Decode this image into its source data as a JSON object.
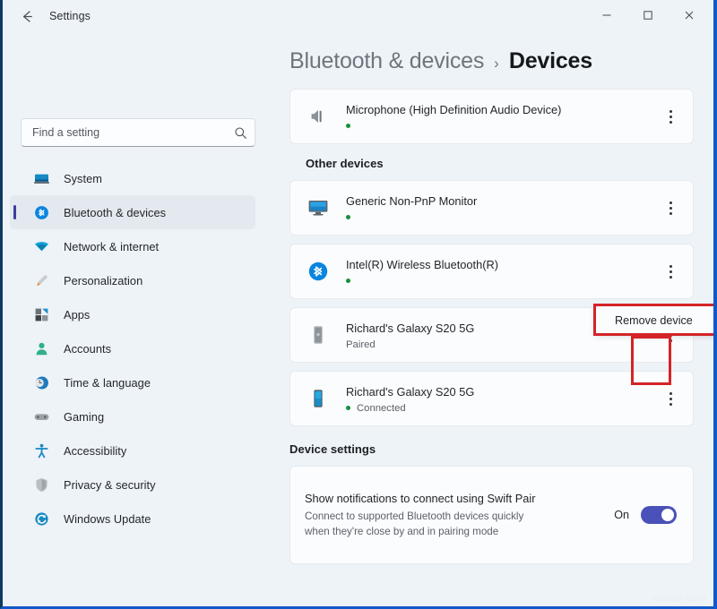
{
  "window": {
    "title": "Settings",
    "back_label": "Back",
    "minimize_label": "Minimize",
    "maximize_label": "Maximize",
    "close_label": "Close",
    "watermark": "wsxdn.com"
  },
  "search": {
    "placeholder": "Find a setting",
    "value": ""
  },
  "sidebar": {
    "items": [
      {
        "label": "System",
        "icon": "monitor-icon",
        "selected": false
      },
      {
        "label": "Bluetooth & devices",
        "icon": "bluetooth-icon",
        "selected": true
      },
      {
        "label": "Network & internet",
        "icon": "wifi-icon",
        "selected": false
      },
      {
        "label": "Personalization",
        "icon": "paintbrush-icon",
        "selected": false
      },
      {
        "label": "Apps",
        "icon": "apps-icon",
        "selected": false
      },
      {
        "label": "Accounts",
        "icon": "person-icon",
        "selected": false
      },
      {
        "label": "Time & language",
        "icon": "clock-globe-icon",
        "selected": false
      },
      {
        "label": "Gaming",
        "icon": "gamepad-icon",
        "selected": false
      },
      {
        "label": "Accessibility",
        "icon": "accessibility-icon",
        "selected": false
      },
      {
        "label": "Privacy & security",
        "icon": "shield-icon",
        "selected": false
      },
      {
        "label": "Windows Update",
        "icon": "update-icon",
        "selected": false
      }
    ]
  },
  "breadcrumb": {
    "parent": "Bluetooth & devices",
    "separator": "›",
    "current": "Devices"
  },
  "audio_devices": [
    {
      "name": "Microphone (High Definition Audio Device)",
      "icon": "speaker-icon",
      "status_text": "",
      "has_dot": true,
      "menu_label": "More options"
    }
  ],
  "other_devices": {
    "heading": "Other devices",
    "items": [
      {
        "name": "Generic Non-PnP Monitor",
        "icon": "monitor-device-icon",
        "status_text": "",
        "has_dot": true,
        "menu_label": "More options"
      },
      {
        "name": "Intel(R) Wireless Bluetooth(R)",
        "icon": "bluetooth-device-icon",
        "status_text": "",
        "has_dot": true,
        "menu_label": "More options"
      },
      {
        "name": "Richard's Galaxy S20 5G",
        "icon": "phone-gray-icon",
        "status_text": "Paired",
        "has_dot": false,
        "menu_label": "More options"
      },
      {
        "name": "Richard's Galaxy S20 5G",
        "icon": "phone-blue-icon",
        "status_text": "Connected",
        "has_dot": true,
        "menu_label": "More options"
      }
    ]
  },
  "context_menu": {
    "items": [
      {
        "label": "Remove device"
      }
    ]
  },
  "device_settings": {
    "heading": "Device settings",
    "swift_pair": {
      "title": "Show notifications to connect using Swift Pair",
      "description": "Connect to supported Bluetooth devices quickly when they're close by and in pairing mode",
      "toggle_state": "On"
    }
  },
  "colors": {
    "accent": "#4a51b8",
    "selection_bar": "#3b3f9e",
    "status_dot": "#1a8f3c",
    "annotation": "#d42427",
    "bluetooth_blue": "#0a84e0",
    "page_bg": "#eef3f8",
    "card_bg": "#fafcfe"
  }
}
